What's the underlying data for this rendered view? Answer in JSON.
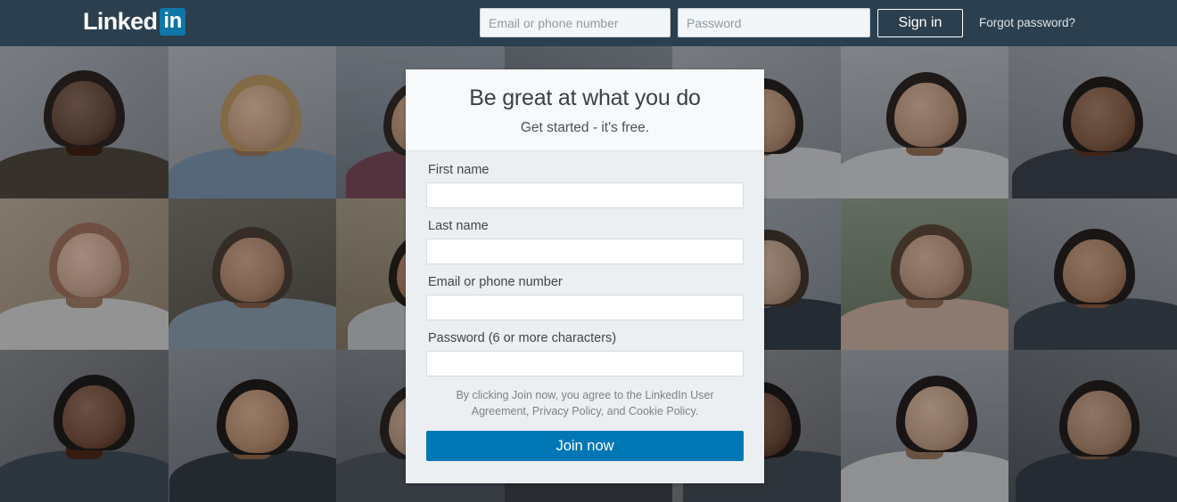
{
  "nav": {
    "logo_word": "Linked",
    "logo_badge": "in",
    "email_placeholder": "Email or phone number",
    "password_placeholder": "Password",
    "signin_label": "Sign in",
    "forgot_label": "Forgot password?"
  },
  "card": {
    "title": "Be great at what you do",
    "subtitle": "Get started - it's free.",
    "fields": [
      {
        "label": "First name",
        "value": "",
        "placeholder": ""
      },
      {
        "label": "Last name",
        "value": "",
        "placeholder": ""
      },
      {
        "label": "Email or phone number",
        "value": "",
        "placeholder": ""
      },
      {
        "label": "Password (6 or more characters)",
        "value": "",
        "placeholder": ""
      }
    ],
    "legal": "By clicking Join now, you agree to the LinkedIn User Agreement, Privacy Policy, and Cookie Policy.",
    "join_label": "Join now"
  },
  "colors": {
    "nav_bg": "#2b3f4e",
    "brand_blue": "#0077b5",
    "logo_badge_bg": "#0e76a8",
    "card_body_bg": "#eceff1",
    "card_header_bg": "#f8f9fa"
  },
  "background": {
    "description": "photo-collage-of-professional-headshots",
    "tiles": [
      {
        "bg": "#b9bfc6",
        "skin": "#6b4a35",
        "hair": "#241a14",
        "cloth": "#4a4334"
      },
      {
        "bg": "#c3c8cd",
        "skin": "#d8ab8a",
        "hair": "#c9a063",
        "cloth": "#7e9cb5"
      },
      {
        "bg": "#9fa9b2",
        "skin": "#c79a78",
        "hair": "#2a2119",
        "cloth": "#7a4654"
      },
      {
        "bg": "#8d959d",
        "skin": "#a8795c",
        "hair": "#171310",
        "cloth": "#2f3a44"
      },
      {
        "bg": "#b6bcc2",
        "skin": "#c79a7a",
        "hair": "#1b1512",
        "cloth": "#dfe2e4"
      },
      {
        "bg": "#c4c9ce",
        "skin": "#cfa384",
        "hair": "#241b15",
        "cloth": "#e3e5e7"
      },
      {
        "bg": "#b0b6bc",
        "skin": "#8d6043",
        "hair": "#17110d",
        "cloth": "#343c46"
      },
      {
        "bg": "#c9b79f",
        "skin": "#dcb39a",
        "hair": "#a9745a",
        "cloth": "#e6e4e2"
      },
      {
        "bg": "#7f7a6e",
        "skin": "#c09070",
        "hair": "#4a3a2c",
        "cloth": "#8fa3b4"
      },
      {
        "bg": "#b6a98f",
        "skin": "#b5805e",
        "hair": "#1d1610",
        "cloth": "#cfd3d6"
      },
      {
        "bg": "#5d6b52",
        "skin": "#7a4f38",
        "hair": "#191310",
        "cloth": "#c4485a"
      },
      {
        "bg": "#aeb6bd",
        "skin": "#cba98d",
        "hair": "#3d2d20",
        "cloth": "#2d3742"
      },
      {
        "bg": "#94a48c",
        "skin": "#cba185",
        "hair": "#5c4330",
        "cloth": "#d9b9a6"
      },
      {
        "bg": "#a7adb3",
        "skin": "#b98b68",
        "hair": "#1c1510",
        "cloth": "#38424c"
      },
      {
        "bg": "#8c8f93",
        "skin": "#7d513a",
        "hair": "#14100d",
        "cloth": "#3b4856"
      },
      {
        "bg": "#9aa0a6",
        "skin": "#c99a74",
        "hair": "#15100c",
        "cloth": "#2c343c"
      },
      {
        "bg": "#8b9196",
        "skin": "#c4a184",
        "hair": "#241a13",
        "cloth": "#4b535b"
      },
      {
        "bg": "#7e8488",
        "skin": "#b4836a",
        "hair": "#120e0b",
        "cloth": "#343b42"
      },
      {
        "bg": "#96999c",
        "skin": "#6f4a35",
        "hair": "#120d0a",
        "cloth": "#3d464f"
      },
      {
        "bg": "#aab0b6",
        "skin": "#d2ab8c",
        "hair": "#191210",
        "cloth": "#dedfe0"
      },
      {
        "bg": "#7a8186",
        "skin": "#b98f70",
        "hair": "#1a1310",
        "cloth": "#2e3740"
      }
    ]
  }
}
